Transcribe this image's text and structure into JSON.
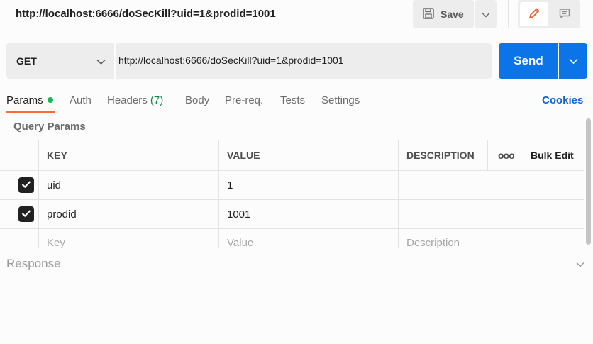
{
  "app": {
    "tab_title": "http://localhost:6666/doSecKill?uid=1&prodid=1001"
  },
  "toolbar": {
    "save_label": "Save",
    "save_icon": "save-icon",
    "save_menu_icon": "chevron-down-icon",
    "edit_icon": "pencil-icon",
    "comment_icon": "comment-icon"
  },
  "request": {
    "method": "GET",
    "url": "http://localhost:6666/doSecKill?uid=1&prodid=1001",
    "send_label": "Send"
  },
  "tabs": {
    "params": "Params",
    "auth": "Auth",
    "headers": "Headers",
    "headers_count": "(7)",
    "body": "Body",
    "prereq": "Pre-req.",
    "tests": "Tests",
    "settings": "Settings",
    "cookies": "Cookies"
  },
  "query_params": {
    "title": "Query Params",
    "headers": {
      "key": "KEY",
      "value": "VALUE",
      "description": "DESCRIPTION",
      "more": "ooo",
      "bulk_edit": "Bulk Edit"
    },
    "rows": [
      {
        "checked": true,
        "key": "uid",
        "value": "1",
        "description": ""
      },
      {
        "checked": true,
        "key": "prodid",
        "value": "1001",
        "description": ""
      }
    ],
    "placeholders": {
      "key": "Key",
      "value": "Value",
      "description": "Description"
    }
  },
  "response": {
    "title": "Response"
  },
  "colors": {
    "accent_send": "#0b74e8",
    "active_tab_underline": "#ff6c37",
    "status_dot": "#0cbb52",
    "edit_icon": "#e8612c",
    "cookies_link": "#0b66d1"
  }
}
